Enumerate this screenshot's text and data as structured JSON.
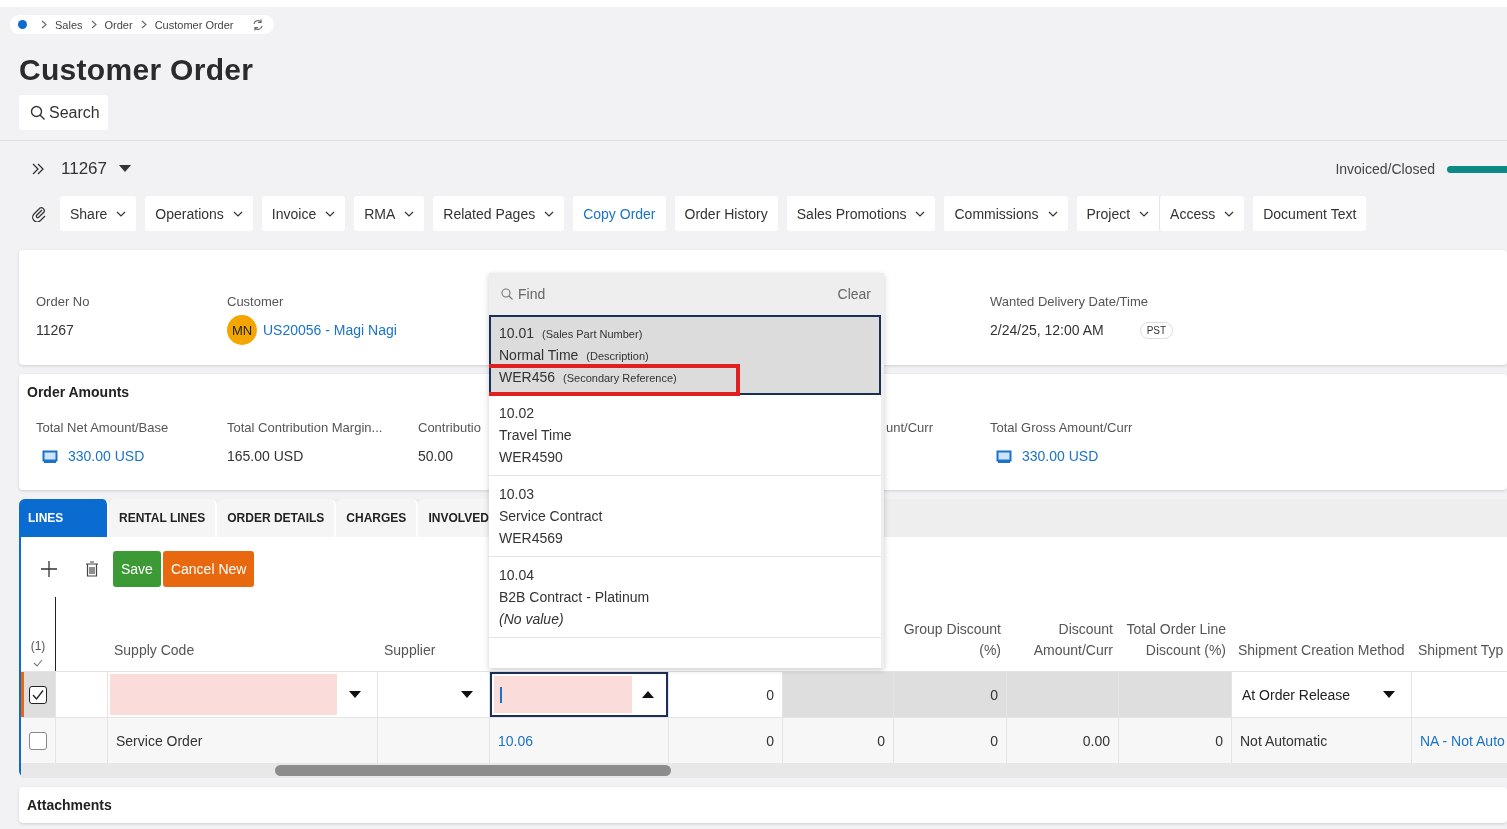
{
  "breadcrumb": [
    "Sales",
    "Order",
    "Customer Order"
  ],
  "title": "Customer Order",
  "search_button": "Search",
  "record": {
    "id": "11267",
    "status": "Invoiced/Closed",
    "level": 1
  },
  "toolbar": [
    {
      "label": "Share",
      "kind": "menu"
    },
    {
      "label": "Operations",
      "kind": "menu"
    },
    {
      "label": "Invoice",
      "kind": "menu"
    },
    {
      "label": "RMA",
      "kind": "menu"
    },
    {
      "label": "Related Pages",
      "kind": "menu"
    },
    {
      "label": "Copy Order",
      "kind": "link"
    },
    {
      "label": "Order History",
      "kind": "plain"
    },
    {
      "label": "Sales Promotions",
      "kind": "menu"
    },
    {
      "label": "Commissions",
      "kind": "menu"
    },
    {
      "label": "Project",
      "kind": "menu"
    },
    {
      "label": "Access",
      "kind": "menu"
    },
    {
      "label": "Document Text",
      "kind": "plain"
    }
  ],
  "header_fields": [
    {
      "label": "Order No",
      "value": "11267",
      "kind": "text"
    },
    {
      "label": "Customer",
      "value": "US20056 - Magi Nagi",
      "avatar": "MN",
      "kind": "link"
    },
    {
      "label": "Wanted Delivery Date/Time",
      "value": "2/24/25, 12:00 AM",
      "badge": "PST",
      "kind": "text"
    }
  ],
  "order_amounts": {
    "title": "Order Amounts",
    "fields": [
      {
        "label": "Total Net Amount/Base",
        "value": "330.00 USD",
        "kind": "money-link"
      },
      {
        "label": "Total Contribution Margin...",
        "value": "165.00 USD",
        "kind": "text"
      },
      {
        "label": "Contributio",
        "value": "50.00",
        "kind": "text"
      },
      {
        "label": "unt/Curr",
        "kind": "label-only"
      },
      {
        "label": "Total Gross Amount/Curr",
        "value": "330.00 USD",
        "kind": "money-link"
      }
    ]
  },
  "tabs": [
    {
      "label": "LINES",
      "selected": true
    },
    {
      "label": "RENTAL LINES",
      "selected": false
    },
    {
      "label": "ORDER DETAILS",
      "selected": false
    },
    {
      "label": "CHARGES",
      "selected": false
    },
    {
      "label": "INVOLVED",
      "selected": false
    }
  ],
  "lines_toolbar": {
    "save": "Save",
    "cancel": "Cancel New"
  },
  "columns": [
    {
      "kind": "select-all",
      "label": "(1)"
    },
    {
      "kind": "covered"
    },
    {
      "kind": "text",
      "label": "Supply Code"
    },
    {
      "kind": "text",
      "label": "Supplier"
    },
    {
      "kind": "covered"
    },
    {
      "kind": "covered"
    },
    {
      "kind": "covered"
    },
    {
      "kind": "number",
      "label": "Group Discount (%)"
    },
    {
      "kind": "number",
      "label": "Discount Amount/Curr"
    },
    {
      "kind": "number",
      "label": "Total Order Line Discount (%)"
    },
    {
      "kind": "text",
      "label": "Shipment Creation Method"
    },
    {
      "kind": "text",
      "label": "Shipment Typ"
    }
  ],
  "rows": [
    {
      "selected": true,
      "cells": [
        {
          "kind": "checkbox",
          "checked": true
        },
        {
          "kind": "blank"
        },
        {
          "kind": "select",
          "required": true
        },
        {
          "kind": "select",
          "required": false
        },
        {
          "kind": "lookup",
          "required": true
        },
        {
          "kind": "number",
          "value": "0"
        },
        {
          "kind": "readonly"
        },
        {
          "kind": "readonly",
          "value": "0"
        },
        {
          "kind": "readonly"
        },
        {
          "kind": "readonly"
        },
        {
          "kind": "select",
          "required": false,
          "value": "At Order Release"
        },
        {
          "kind": "blank"
        }
      ]
    },
    {
      "selected": false,
      "cells": [
        {
          "kind": "checkbox",
          "checked": false
        },
        {
          "kind": "blank"
        },
        {
          "kind": "text",
          "value": "Service Order"
        },
        {
          "kind": "blank"
        },
        {
          "kind": "link",
          "value": "10.06"
        },
        {
          "kind": "number",
          "value": "0"
        },
        {
          "kind": "number",
          "value": "0"
        },
        {
          "kind": "number",
          "value": "0"
        },
        {
          "kind": "number",
          "value": "0.00"
        },
        {
          "kind": "number",
          "value": "0"
        },
        {
          "kind": "text",
          "value": "Not Automatic"
        },
        {
          "kind": "link",
          "value": "NA - Not Auto"
        }
      ]
    }
  ],
  "attachments": "Attachments",
  "lookup_dropdown": {
    "placeholder": "Find",
    "clear": "Clear",
    "items": [
      {
        "selected": true,
        "lines": [
          {
            "kind": "value",
            "value": "10.01",
            "hint": "(Sales Part Number)",
            "highlighted": false
          },
          {
            "kind": "value",
            "value": "Normal Time",
            "hint": "(Description)",
            "highlighted": false
          },
          {
            "kind": "value",
            "value": "WER456",
            "hint": "(Secondary Reference)",
            "highlighted": true
          }
        ]
      },
      {
        "selected": false,
        "lines": [
          {
            "kind": "value",
            "value": "10.02",
            "highlighted": false
          },
          {
            "kind": "value",
            "value": "Travel Time",
            "highlighted": false
          },
          {
            "kind": "value",
            "value": "WER4590",
            "highlighted": false
          }
        ]
      },
      {
        "selected": false,
        "lines": [
          {
            "kind": "value",
            "value": "10.03",
            "highlighted": false
          },
          {
            "kind": "value",
            "value": "Service Contract",
            "highlighted": false
          },
          {
            "kind": "value",
            "value": "WER4569",
            "highlighted": false
          }
        ]
      },
      {
        "selected": false,
        "lines": [
          {
            "kind": "value",
            "value": "10.04",
            "highlighted": false
          },
          {
            "kind": "value",
            "value": "B2B Contract - Platinum",
            "highlighted": false
          },
          {
            "kind": "none",
            "value": "(No value)",
            "highlighted": false
          }
        ]
      }
    ]
  }
}
